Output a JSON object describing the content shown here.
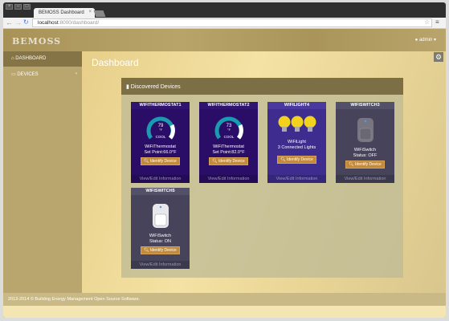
{
  "browser": {
    "tab_title": "BEMOSS Dashboard",
    "url_host": "localhost",
    "url_path": ":8000/dashboard/"
  },
  "header": {
    "logo": "BEMOSS",
    "user": "admin"
  },
  "sidebar": {
    "items": [
      {
        "label": "DASHBOARD"
      },
      {
        "label": "DEVICES"
      }
    ]
  },
  "main": {
    "title": "Dashboard"
  },
  "panel": {
    "title": "Discovered Devices"
  },
  "devices": [
    {
      "name": "WIFITHERMOSTAT1",
      "temp": "79",
      "unit": "°F",
      "mode": "COOL",
      "line1": "WiFiThermostat",
      "line2": "Set Point:66.0°F"
    },
    {
      "name": "WIFITHERMOSTAT2",
      "temp": "73",
      "unit": "°F",
      "mode": "COOL",
      "line1": "WiFiThermostat",
      "line2": "Set Point:82.0°F"
    },
    {
      "name": "WIFILIGHT4",
      "line1": "WiFiLight",
      "line2": "3 Connected Lights"
    },
    {
      "name": "WIFISWITCH3",
      "line1": "WiFiSwitch",
      "line2": "Status: OFF"
    },
    {
      "name": "WIFISWITCH5",
      "line1": "WiFiSwitch",
      "line2": "Status: ON"
    }
  ],
  "buttons": {
    "identify": "Identify Device",
    "view_edit": "View/Edit Information"
  },
  "footer": {
    "text": "2013-2014 © Building Energy Management Open Source Software."
  },
  "colors": {
    "thermostat_bg": "#2a0d66",
    "light_bg": "#3e2d8e",
    "switch_bg": "#46435a",
    "button": "#c28b3c",
    "gauge": "#1a9bb0"
  }
}
